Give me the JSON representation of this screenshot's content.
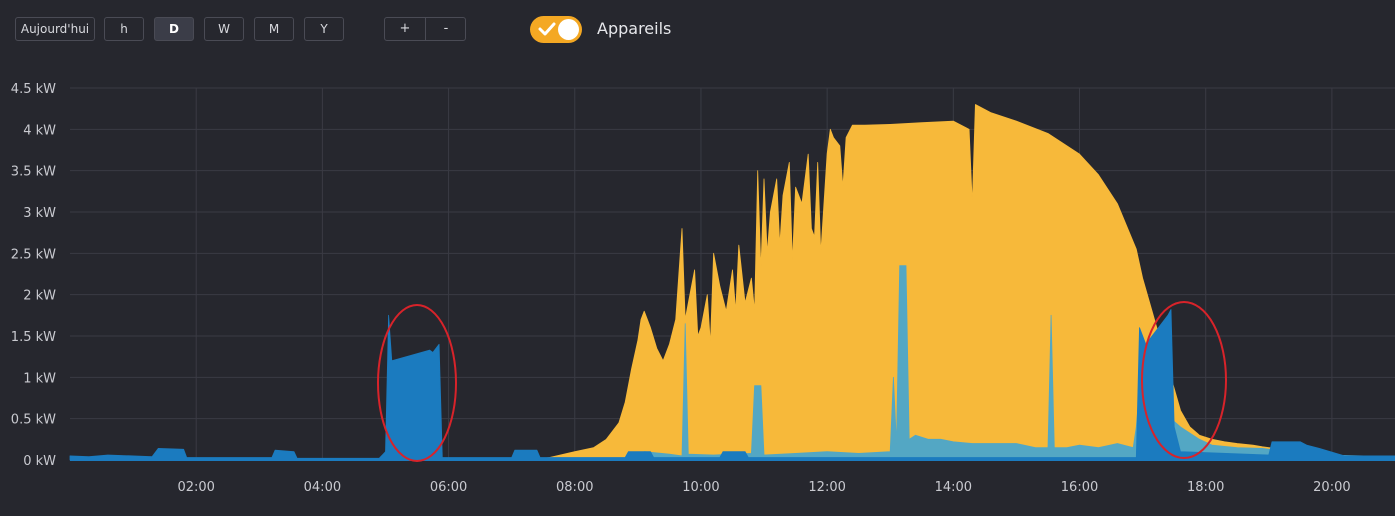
{
  "toolbar": {
    "today_label": "Aujourd'hui",
    "range_buttons": [
      {
        "label": "h",
        "active": false
      },
      {
        "label": "D",
        "active": true
      },
      {
        "label": "W",
        "active": false
      },
      {
        "label": "M",
        "active": false
      },
      {
        "label": "Y",
        "active": false
      }
    ],
    "zoom_in_label": "+",
    "zoom_out_label": "-",
    "devices_toggle": {
      "label": "Appareils",
      "on": true,
      "color": "#f4a823"
    }
  },
  "chart_data": {
    "type": "area",
    "title": "",
    "xlabel": "",
    "ylabel": "",
    "x_unit": "hour of day",
    "xlim": [
      0,
      21
    ],
    "ylim": [
      0,
      4.5
    ],
    "y_ticks": [
      "0 kW",
      "0.5 kW",
      "1 kW",
      "1.5 kW",
      "2 kW",
      "2.5 kW",
      "3 kW",
      "3.5 kW",
      "4 kW",
      "4.5 kW"
    ],
    "x_ticks": [
      "02:00",
      "04:00",
      "06:00",
      "08:00",
      "10:00",
      "12:00",
      "14:00",
      "16:00",
      "18:00",
      "20:00"
    ],
    "grid": true,
    "legend": "none",
    "series": [
      {
        "color": "#f7b93a",
        "points": [
          [
            7.3,
            0
          ],
          [
            7.6,
            0.03
          ],
          [
            8.0,
            0.1
          ],
          [
            8.3,
            0.15
          ],
          [
            8.5,
            0.25
          ],
          [
            8.7,
            0.45
          ],
          [
            8.8,
            0.7
          ],
          [
            8.9,
            1.1
          ],
          [
            9.0,
            1.45
          ],
          [
            9.05,
            1.7
          ],
          [
            9.1,
            1.8
          ],
          [
            9.2,
            1.6
          ],
          [
            9.3,
            1.35
          ],
          [
            9.4,
            1.2
          ],
          [
            9.5,
            1.4
          ],
          [
            9.6,
            1.7
          ],
          [
            9.7,
            2.8
          ],
          [
            9.75,
            1.7
          ],
          [
            9.8,
            1.9
          ],
          [
            9.9,
            2.3
          ],
          [
            9.95,
            1.5
          ],
          [
            10.0,
            1.6
          ],
          [
            10.1,
            2.0
          ],
          [
            10.15,
            1.4
          ],
          [
            10.2,
            2.5
          ],
          [
            10.3,
            2.1
          ],
          [
            10.4,
            1.8
          ],
          [
            10.5,
            2.3
          ],
          [
            10.55,
            1.8
          ],
          [
            10.6,
            2.6
          ],
          [
            10.7,
            1.9
          ],
          [
            10.8,
            2.2
          ],
          [
            10.85,
            1.8
          ],
          [
            10.9,
            3.5
          ],
          [
            10.95,
            2.3
          ],
          [
            11.0,
            3.4
          ],
          [
            11.05,
            2.5
          ],
          [
            11.1,
            3.0
          ],
          [
            11.2,
            3.4
          ],
          [
            11.25,
            2.6
          ],
          [
            11.3,
            3.2
          ],
          [
            11.4,
            3.6
          ],
          [
            11.45,
            2.4
          ],
          [
            11.5,
            3.3
          ],
          [
            11.6,
            3.1
          ],
          [
            11.7,
            3.7
          ],
          [
            11.75,
            2.8
          ],
          [
            11.8,
            2.7
          ],
          [
            11.85,
            3.6
          ],
          [
            11.9,
            2.5
          ],
          [
            12.0,
            3.7
          ],
          [
            12.05,
            4.0
          ],
          [
            12.1,
            3.9
          ],
          [
            12.2,
            3.8
          ],
          [
            12.25,
            3.3
          ],
          [
            12.3,
            3.9
          ],
          [
            12.4,
            4.05
          ],
          [
            12.6,
            4.05
          ],
          [
            13.0,
            4.06
          ],
          [
            13.5,
            4.08
          ],
          [
            14.0,
            4.1
          ],
          [
            14.25,
            4.0
          ],
          [
            14.3,
            3.1
          ],
          [
            14.35,
            4.3
          ],
          [
            14.6,
            4.2
          ],
          [
            15.0,
            4.1
          ],
          [
            15.5,
            3.95
          ],
          [
            16.0,
            3.7
          ],
          [
            16.3,
            3.45
          ],
          [
            16.6,
            3.1
          ],
          [
            16.9,
            2.55
          ],
          [
            17.0,
            2.2
          ],
          [
            17.15,
            1.8
          ],
          [
            17.3,
            1.4
          ],
          [
            17.45,
            1.0
          ],
          [
            17.6,
            0.6
          ],
          [
            17.75,
            0.4
          ],
          [
            17.9,
            0.3
          ],
          [
            18.1,
            0.25
          ],
          [
            18.3,
            0.22
          ],
          [
            18.5,
            0.2
          ],
          [
            18.75,
            0.18
          ],
          [
            18.9,
            0.16
          ],
          [
            19.1,
            0.14
          ],
          [
            19.3,
            0.12
          ],
          [
            19.5,
            0.09
          ],
          [
            19.7,
            0.06
          ],
          [
            19.8,
            0.04
          ],
          [
            19.9,
            0
          ]
        ]
      },
      {
        "color": "#53a7c4",
        "points": [
          [
            9.0,
            0
          ],
          [
            9.1,
            0.1
          ],
          [
            9.5,
            0.07
          ],
          [
            9.7,
            0.05
          ],
          [
            9.75,
            1.65
          ],
          [
            9.8,
            0.07
          ],
          [
            10.2,
            0.06
          ],
          [
            10.5,
            0.07
          ],
          [
            10.8,
            0.08
          ],
          [
            10.85,
            0.9
          ],
          [
            10.95,
            0.9
          ],
          [
            11.0,
            0.06
          ],
          [
            11.5,
            0.08
          ],
          [
            12.0,
            0.1
          ],
          [
            12.5,
            0.08
          ],
          [
            13.0,
            0.1
          ],
          [
            13.05,
            1.0
          ],
          [
            13.1,
            0.2
          ],
          [
            13.15,
            2.35
          ],
          [
            13.25,
            2.35
          ],
          [
            13.3,
            0.25
          ],
          [
            13.4,
            0.3
          ],
          [
            13.6,
            0.25
          ],
          [
            13.8,
            0.25
          ],
          [
            14.0,
            0.22
          ],
          [
            14.3,
            0.2
          ],
          [
            14.6,
            0.2
          ],
          [
            15.0,
            0.2
          ],
          [
            15.3,
            0.15
          ],
          [
            15.5,
            0.15
          ],
          [
            15.55,
            1.75
          ],
          [
            15.6,
            0.15
          ],
          [
            15.8,
            0.15
          ],
          [
            16.0,
            0.18
          ],
          [
            16.3,
            0.15
          ],
          [
            16.6,
            0.2
          ],
          [
            16.85,
            0.15
          ],
          [
            16.9,
            0.4
          ],
          [
            17.0,
            1.3
          ],
          [
            17.1,
            0.9
          ],
          [
            17.3,
            0.6
          ],
          [
            17.6,
            0.4
          ],
          [
            17.9,
            0.25
          ],
          [
            18.1,
            0.18
          ],
          [
            18.5,
            0.15
          ],
          [
            18.9,
            0.14
          ],
          [
            19.3,
            0.1
          ],
          [
            19.6,
            0.08
          ],
          [
            19.9,
            0.06
          ],
          [
            20.5,
            0.05
          ],
          [
            21.0,
            0.05
          ]
        ]
      },
      {
        "color": "#1b7bbf",
        "points": [
          [
            0.0,
            0.05
          ],
          [
            0.3,
            0.04
          ],
          [
            0.6,
            0.06
          ],
          [
            1.0,
            0.05
          ],
          [
            1.3,
            0.04
          ],
          [
            1.4,
            0.14
          ],
          [
            1.8,
            0.13
          ],
          [
            1.85,
            0.03
          ],
          [
            3.2,
            0.03
          ],
          [
            3.25,
            0.12
          ],
          [
            3.55,
            0.1
          ],
          [
            3.6,
            0.02
          ],
          [
            4.9,
            0.02
          ],
          [
            5.0,
            0.1
          ],
          [
            5.05,
            1.75
          ],
          [
            5.1,
            1.2
          ],
          [
            5.7,
            1.33
          ],
          [
            5.75,
            1.3
          ],
          [
            5.85,
            1.4
          ],
          [
            5.9,
            0.03
          ],
          [
            7.0,
            0.03
          ],
          [
            7.05,
            0.12
          ],
          [
            7.4,
            0.12
          ],
          [
            7.45,
            0.03
          ],
          [
            8.8,
            0.03
          ],
          [
            8.85,
            0.1
          ],
          [
            9.2,
            0.1
          ],
          [
            9.25,
            0.03
          ],
          [
            10.3,
            0.03
          ],
          [
            10.35,
            0.1
          ],
          [
            10.7,
            0.1
          ],
          [
            10.75,
            0.03
          ],
          [
            16.9,
            0.03
          ],
          [
            16.95,
            1.6
          ],
          [
            17.05,
            1.4
          ],
          [
            17.4,
            1.75
          ],
          [
            17.45,
            1.82
          ],
          [
            17.5,
            0.4
          ],
          [
            17.6,
            0.1
          ],
          [
            19.0,
            0.06
          ],
          [
            19.05,
            0.22
          ],
          [
            19.5,
            0.22
          ],
          [
            19.6,
            0.18
          ],
          [
            19.8,
            0.14
          ],
          [
            20.2,
            0.05
          ],
          [
            20.5,
            0.05
          ],
          [
            21.0,
            0.05
          ]
        ]
      }
    ]
  }
}
